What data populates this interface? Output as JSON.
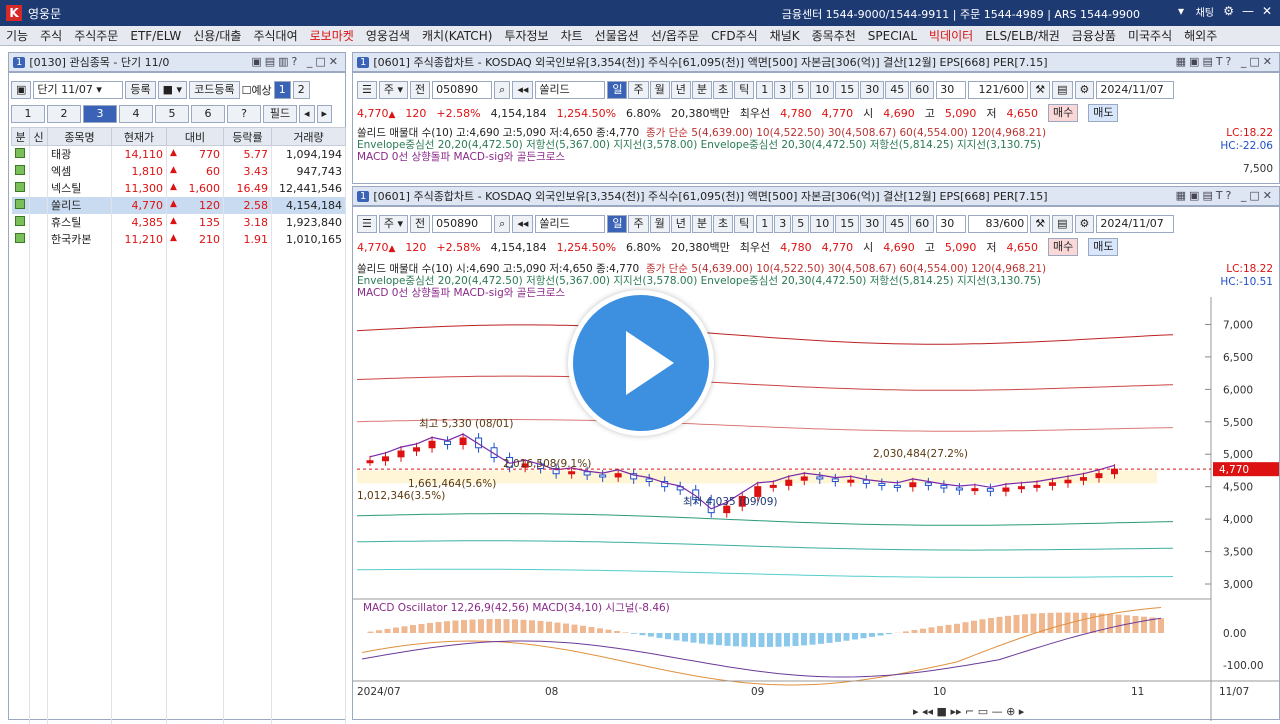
{
  "app": {
    "title": "영웅문",
    "info": "금융센터 1544-9000/1544-9911 | 주문 1544-4989 | ARS 1544-9900",
    "chat": "채팅"
  },
  "menu": [
    "기능",
    "주식",
    "주식주문",
    "ETF/ELW",
    "신용/대출",
    "주식대여",
    "로보마켓",
    "영웅검색",
    "캐치(KATCH)",
    "투자정보",
    "차트",
    "선물옵션",
    "선/옵주문",
    "CFD주식",
    "채널K",
    "종목추천",
    "SPECIAL",
    "빅데이터",
    "ELS/ELB/채권",
    "금융상품",
    "미국주식",
    "해외주"
  ],
  "watchlist": {
    "title": "[0130] 관심종목 - 단기 11/0",
    "group": "단기 11/07",
    "register": "등록",
    "code_register": "코드등록",
    "forecast": "예상",
    "tabs": [
      "1",
      "2",
      "3",
      "4",
      "5",
      "6",
      "?"
    ],
    "field": "필드",
    "page1": "1",
    "page2": "2",
    "headers": [
      "분",
      "신",
      "종목명",
      "현재가",
      "대비",
      "등락률",
      "거래량"
    ],
    "rows": [
      {
        "name": "태광",
        "price": "14,110",
        "change": "770",
        "rate": "5.77",
        "volume": "1,094,194"
      },
      {
        "name": "엑셈",
        "price": "1,810",
        "change": "60",
        "rate": "3.43",
        "volume": "947,743"
      },
      {
        "name": "넥스틸",
        "price": "11,300",
        "change": "1,600",
        "rate": "16.49",
        "volume": "12,441,546"
      },
      {
        "name": "쏠리드",
        "price": "4,770",
        "change": "120",
        "rate": "2.58",
        "volume": "4,154,184"
      },
      {
        "name": "휴스틸",
        "price": "4,385",
        "change": "135",
        "rate": "3.18",
        "volume": "1,923,840"
      },
      {
        "name": "한국카본",
        "price": "11,210",
        "change": "210",
        "rate": "1.91",
        "volume": "1,010,165"
      }
    ]
  },
  "chart_top": {
    "title": "[0601] 주식종합차트 - KOSDAQ 외국인보유[3,354(천)] 주식수[61,095(천)] 액면[500] 자본금[306(억)] 결산[12월] EPS[668] PER[7.15]",
    "code": "050890",
    "stock": "쏠리드",
    "period": [
      "일",
      "주",
      "월",
      "년",
      "분",
      "초",
      "틱"
    ],
    "nums": [
      "1",
      "3",
      "5",
      "10",
      "15",
      "30",
      "45",
      "60"
    ],
    "count": "30",
    "bars": "121/600",
    "date": "2024/11/07",
    "price": "4,770",
    "change": "120",
    "rate": "+2.58%",
    "volume": "4,154,184",
    "vol_rate": "1,254.50%",
    "turnover": "6.80%",
    "amount": "20,380백만",
    "best": "최우선",
    "ask": "4,780",
    "bid": "4,770",
    "open_lbl": "시",
    "open": "4,690",
    "high_lbl": "고",
    "high": "5,090",
    "low_lbl": "저",
    "low": "4,650",
    "buy": "매수",
    "sell": "매도",
    "legend1": "쏠리드 매물대 수(10)  고:4,690 고:5,090 저:4,650 종:4,770",
    "legend1b": "종가 단순 5(4,639.00)  10(4,522.50)  30(4,508.67)  60(4,554.00)  120(4,968.21)",
    "legend2": "Envelope중심선 20,20(4,472.50)  저항선(5,367.00)  지지선(3,578.00)  Envelope중심선 20,30(4,472.50)  저항선(5,814.25)  지지선(3,130.75)",
    "legend3": "MACD 0선 상향돌파  MACD-sig와 골든크로스",
    "lc": "LC:18.22",
    "hc": "HC:-22.06",
    "tick": "7,500"
  },
  "chart_main": {
    "title": "[0601] 주식종합차트 - KOSDAQ 외국인보유[3,354(천)] 주식수[61,095(천)] 액면[500] 자본금[306(억)] 결산[12월] EPS[668] PER[7.15]",
    "bars": "83/600",
    "lc": "LC:18.22",
    "hc": "HC:-10.51",
    "legend1": "쏠리드 매물대 수(10)  시:4,690 고:5,090 저:4,650 종:4,770",
    "legend1b": "종가 단순 5(4,639.00)  10(4,522.50)  30(4,508.67)  60(4,554.00)  120(4,968.21)",
    "legend2": "Envelope중심선 20,20(4,472.50)  저항선(5,367.00)  지지선(3,578.00)  Envelope중심선 20,30(4,472.50)  저항선(5,814.25)  지지선(3,130.75)",
    "legend3": "MACD 0선 상향돌파  MACD-sig와 골든크로스",
    "yticks": [
      "7,000",
      "6,500",
      "6,000",
      "5,500",
      "5,000",
      "4,500",
      "4,000",
      "3,500",
      "3,000"
    ],
    "price_tag": "4,770",
    "annotations": [
      "최고 5,330 (08/01)",
      "최저 4,035 (09/09)",
      "2,030,484(27.2%)",
      "1,661,464(5.6%)",
      "1,012,346(3.5%)",
      "2,016,508(9.1%)"
    ],
    "macd_legend": "MACD Oscillator 12,26,9(42,56)  MACD(34,10)  시그널(-8.46)",
    "macd_ticks": [
      "0.00",
      "-100.00"
    ],
    "xlabels": [
      "2024/07",
      "08",
      "09",
      "10",
      "11",
      "11/07"
    ]
  },
  "candles": [
    4900,
    4960,
    5050,
    5100,
    5200,
    5150,
    5250,
    5100,
    4950,
    4800,
    4850,
    4780,
    4700,
    4730,
    4680,
    4650,
    4700,
    4620,
    4580,
    4500,
    4450,
    4300,
    4100,
    4200,
    4350,
    4500,
    4520,
    4600,
    4650,
    4620,
    4580,
    4600,
    4550,
    4520,
    4500,
    4560,
    4520,
    4480,
    4450,
    4470,
    4430,
    4480,
    4500,
    4520,
    4560,
    4600,
    4640,
    4700,
    4770
  ],
  "colors": {
    "up": "#d11",
    "down": "#1e50c8",
    "accent": "#3a63b8"
  }
}
